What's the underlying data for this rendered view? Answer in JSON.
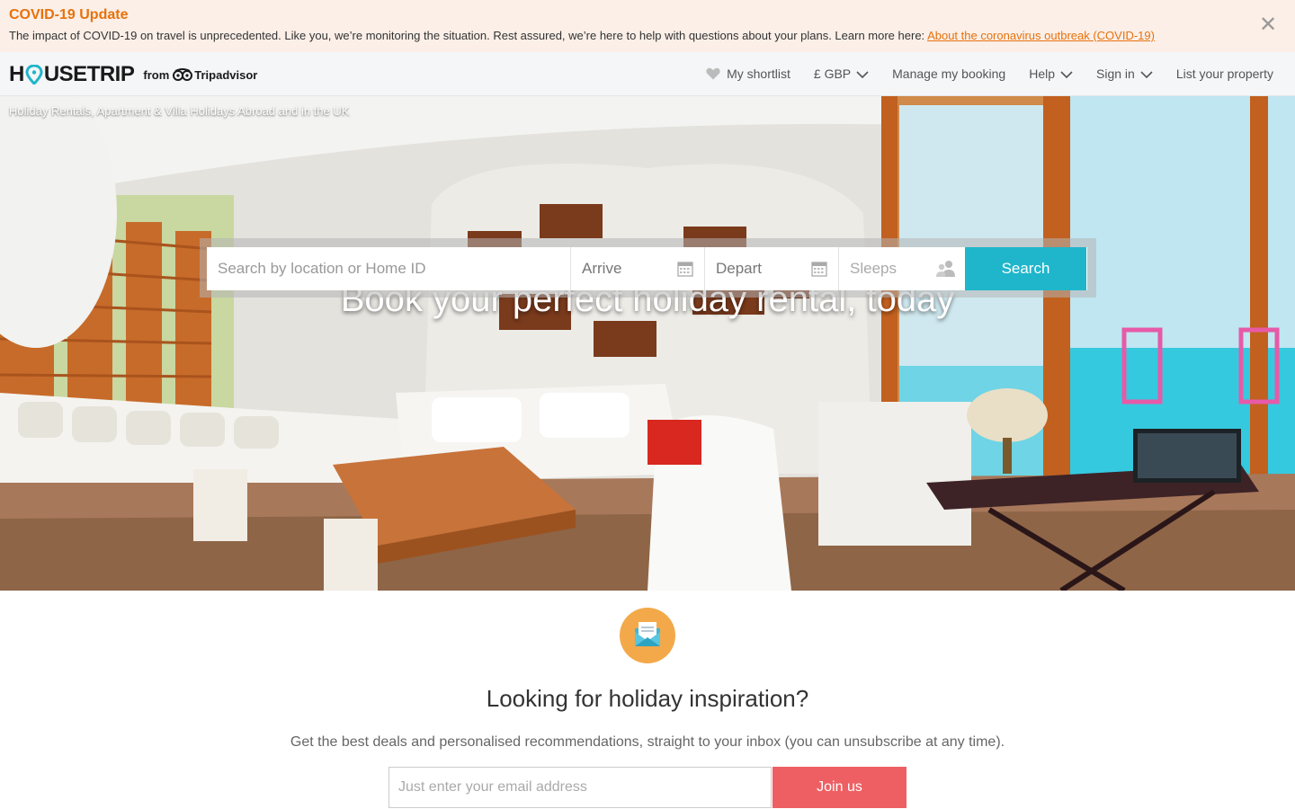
{
  "covid": {
    "title": "COVID-19 Update",
    "text": "The impact of COVID-19 on travel is unprecedented. Like you, we’re monitoring the situation. Rest assured, we’re here to help with questions about your plans. Learn more here: ",
    "link": "About the coronavirus outbreak (COVID-19)",
    "close_icon": "close-icon"
  },
  "header": {
    "logo_main": "H",
    "logo_rest": "USETRIP",
    "logo_from": "from",
    "logo_partner": "Tripadvisor",
    "nav": {
      "shortlist": "My shortlist",
      "currency": "£ GBP",
      "manage": "Manage my booking",
      "help": "Help",
      "signin": "Sign in",
      "list_property": "List your property"
    }
  },
  "hero": {
    "subtitle": "Holiday Rentals, Apartment & Villa Holidays Abroad and in the UK",
    "title": "Book your perfect holiday rental, today",
    "search": {
      "location_placeholder": "Search by location or Home ID",
      "arrive": "Arrive",
      "depart": "Depart",
      "sleeps": "Sleeps",
      "button": "Search"
    }
  },
  "newsletter": {
    "title": "Looking for holiday inspiration?",
    "description": "Get the best deals and personalised recommendations, straight to your inbox (you can unsubscribe at any time).",
    "email_placeholder": "Just enter your email address",
    "button": "Join us"
  },
  "colors": {
    "accent_orange": "#e8710a",
    "search_button": "#1fb6cb",
    "join_button": "#ee5f63",
    "logo_teal": "#1fb6cb"
  }
}
